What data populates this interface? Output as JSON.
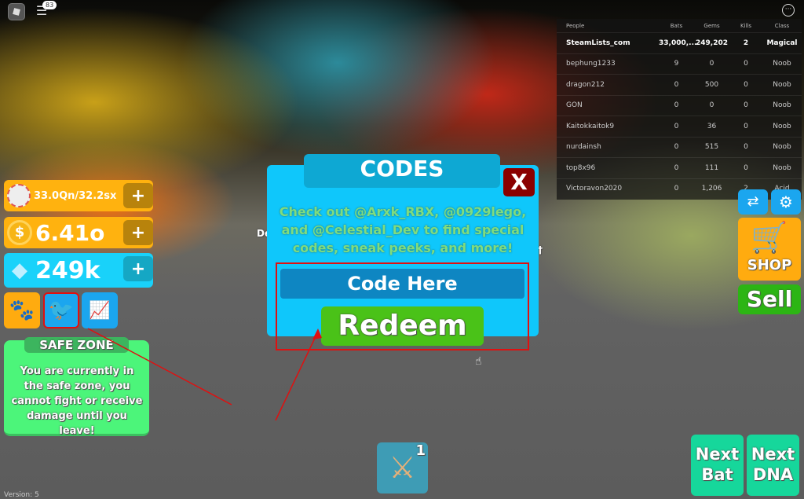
{
  "topbar": {
    "chat_badge": "83",
    "menu_icon": "more-icon"
  },
  "leaderboard": {
    "headers": [
      "People",
      "Bats",
      "Gems",
      "Kills",
      "Class"
    ],
    "rows": [
      {
        "name": "SteamLists_com",
        "bats": "33,000,...",
        "gems": "249,202",
        "kills": "2",
        "class": "Magical"
      },
      {
        "name": "bephung1233",
        "bats": "9",
        "gems": "0",
        "kills": "0",
        "class": "Noob"
      },
      {
        "name": "dragon212",
        "bats": "0",
        "gems": "500",
        "kills": "0",
        "class": "Noob"
      },
      {
        "name": "GON",
        "bats": "0",
        "gems": "0",
        "kills": "0",
        "class": "Noob"
      },
      {
        "name": "Kaitokkaitok9",
        "bats": "0",
        "gems": "36",
        "kills": "0",
        "class": "Noob"
      },
      {
        "name": "nurdainsh",
        "bats": "0",
        "gems": "515",
        "kills": "0",
        "class": "Noob"
      },
      {
        "name": "top8x96",
        "bats": "0",
        "gems": "111",
        "kills": "0",
        "class": "Noob"
      },
      {
        "name": "Victoravon2020",
        "bats": "0",
        "gems": "1,206",
        "kills": "2",
        "class": "Acid"
      }
    ]
  },
  "stats": {
    "bats": "33.0Qn/32.2sx",
    "coins": "6.41o",
    "gems": "249k",
    "plus": "+"
  },
  "safe_zone": {
    "title": "SAFE ZONE",
    "text": "You are currently in the safe zone, you cannot fight or receive damage until you leave!"
  },
  "codes": {
    "title": "CODES",
    "close": "X",
    "description": "Check out @Arxk_RBX, @0929lego, and @Celestial_Dev to find special codes, sneak peeks, and more!",
    "placeholder": "Code Here",
    "redeem": "Redeem"
  },
  "right": {
    "shop": "SHOP",
    "sell": "Sell",
    "next_bat": "Next Bat",
    "next_dna": "Next DNA"
  },
  "hotbar": {
    "slot": "1"
  },
  "version": "Version: 5",
  "bg_text": {
    "left": "De",
    "right": "†"
  },
  "colors": {
    "orange": "#ffb20f",
    "cyan": "#19c8f5",
    "green": "#4cf57a",
    "teal": "#16d79b",
    "red_annotation": "#e01010"
  }
}
